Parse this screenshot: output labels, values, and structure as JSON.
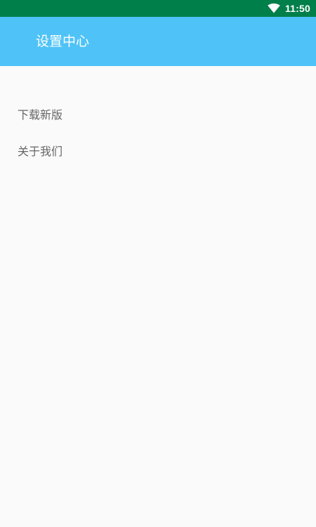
{
  "status_bar": {
    "time": "11:50",
    "background_color": "#017f4b",
    "icons": [
      "wifi-icon"
    ]
  },
  "app_bar": {
    "title": "设置中心",
    "background_color": "#4fc3f7"
  },
  "menu": {
    "items": [
      {
        "label": "下载新版"
      },
      {
        "label": "关于我们"
      }
    ],
    "text_color": "#666666"
  }
}
